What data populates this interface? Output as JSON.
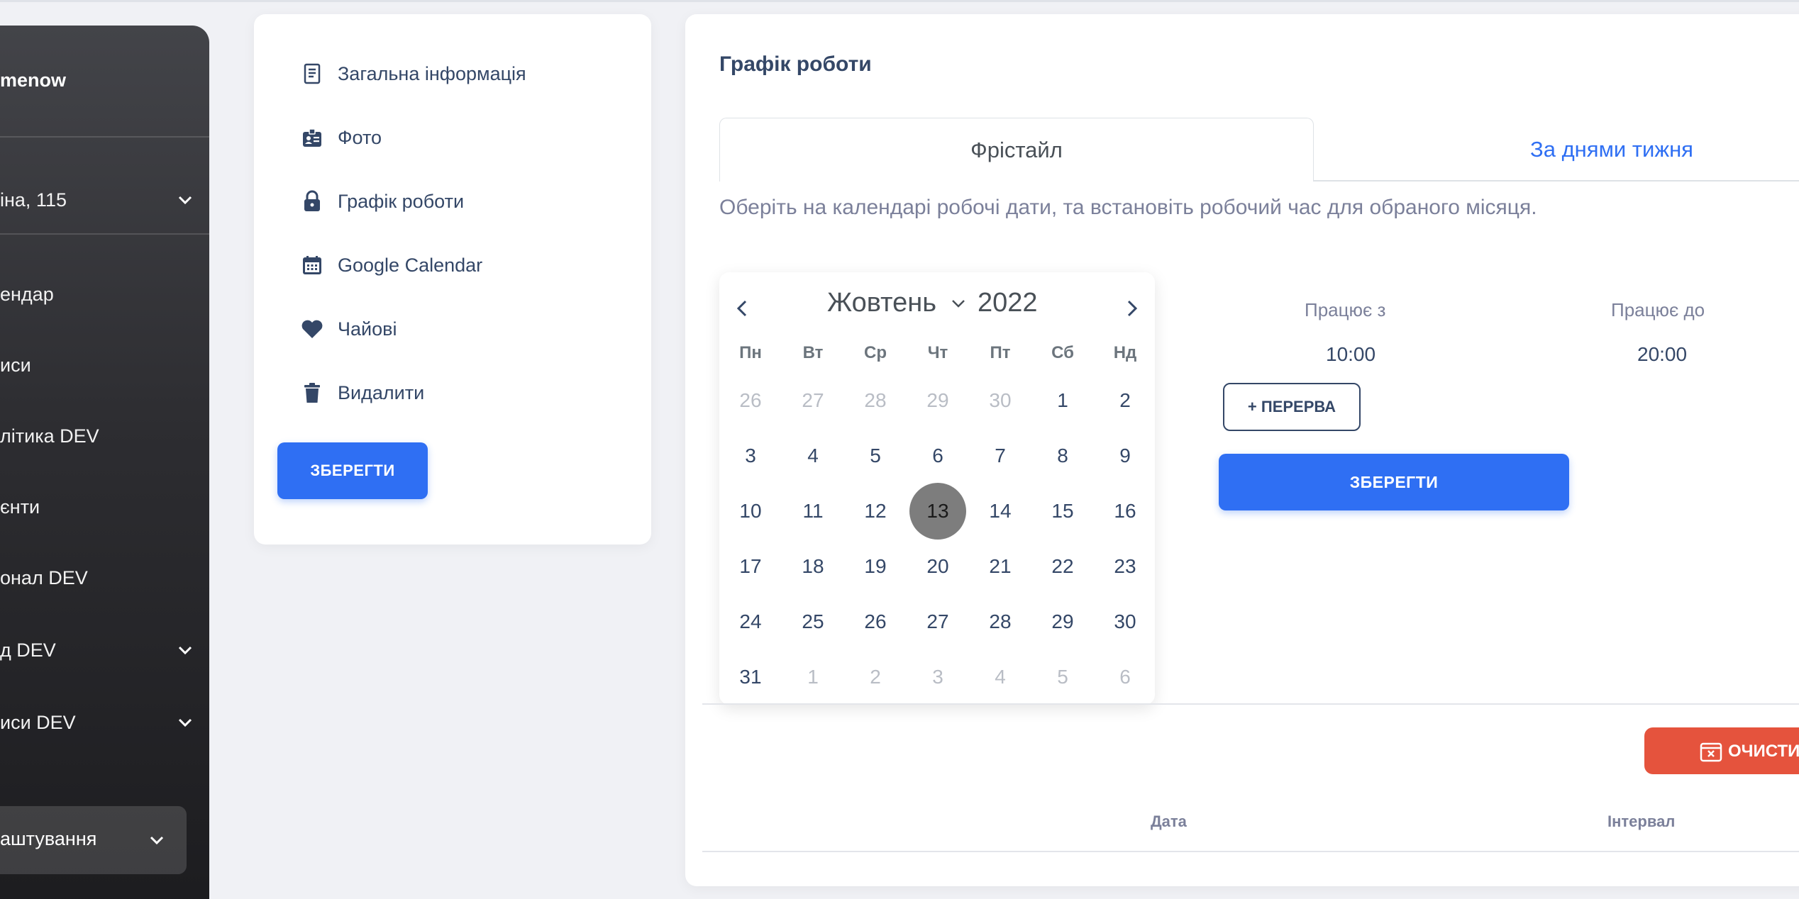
{
  "sidebar": {
    "brand": "menow",
    "location": "іна, 115",
    "items": [
      {
        "label": "ендар",
        "chevron": false
      },
      {
        "label": "иси",
        "chevron": false
      },
      {
        "label": "літика DEV",
        "chevron": false
      },
      {
        "label": "єнти",
        "chevron": false
      },
      {
        "label": "онал DEV",
        "chevron": false
      },
      {
        "label": "д DEV",
        "chevron": true
      },
      {
        "label": "иси DEV",
        "chevron": true
      }
    ],
    "active": "аштування"
  },
  "settings_menu": {
    "items": [
      {
        "label": "Загальна інформація",
        "icon": "receipt-icon"
      },
      {
        "label": "Фото",
        "icon": "id-badge-icon"
      },
      {
        "label": "Графік роботи",
        "icon": "lock-icon"
      },
      {
        "label": "Google Calendar",
        "icon": "calendar-icon"
      },
      {
        "label": "Чайові",
        "icon": "heart-icon"
      },
      {
        "label": "Видалити",
        "icon": "trash-icon"
      }
    ],
    "save_label": "ЗБЕРЕГТИ"
  },
  "schedule": {
    "title": "Графік роботи",
    "tabs": [
      {
        "label": "Фрістайл",
        "active": true
      },
      {
        "label": "За днями тижня",
        "active": false
      }
    ],
    "hint": "Оберіть на календарі робочі дати, та встановіть робочий час для обраного місяця.",
    "calendar": {
      "month": "Жовтень",
      "year": "2022",
      "weekdays": [
        "Пн",
        "Вт",
        "Ср",
        "Чт",
        "Пт",
        "Сб",
        "Нд"
      ],
      "weeks": [
        [
          "26",
          "27",
          "28",
          "29",
          "30",
          "1",
          "2"
        ],
        [
          "3",
          "4",
          "5",
          "6",
          "7",
          "8",
          "9"
        ],
        [
          "10",
          "11",
          "12",
          "13",
          "14",
          "15",
          "16"
        ],
        [
          "17",
          "18",
          "19",
          "20",
          "21",
          "22",
          "23"
        ],
        [
          "24",
          "25",
          "26",
          "27",
          "28",
          "29",
          "30"
        ],
        [
          "31",
          "1",
          "2",
          "3",
          "4",
          "5",
          "6"
        ]
      ],
      "selected_day": "13"
    },
    "works_from_label": "Працює з",
    "works_to_label": "Працює до",
    "works_from": "10:00",
    "works_to": "20:00",
    "break_label": "+ ПЕРЕРВА",
    "save_label": "ЗБЕРЕГТИ",
    "clear_label": "ОЧИСТИТ",
    "table_headers": [
      "Дата",
      "Інтервал"
    ]
  },
  "colors": {
    "primary": "#2f6ff3",
    "danger": "#e5533d",
    "text": "#344767",
    "selected_day": "#7d7d7d"
  }
}
